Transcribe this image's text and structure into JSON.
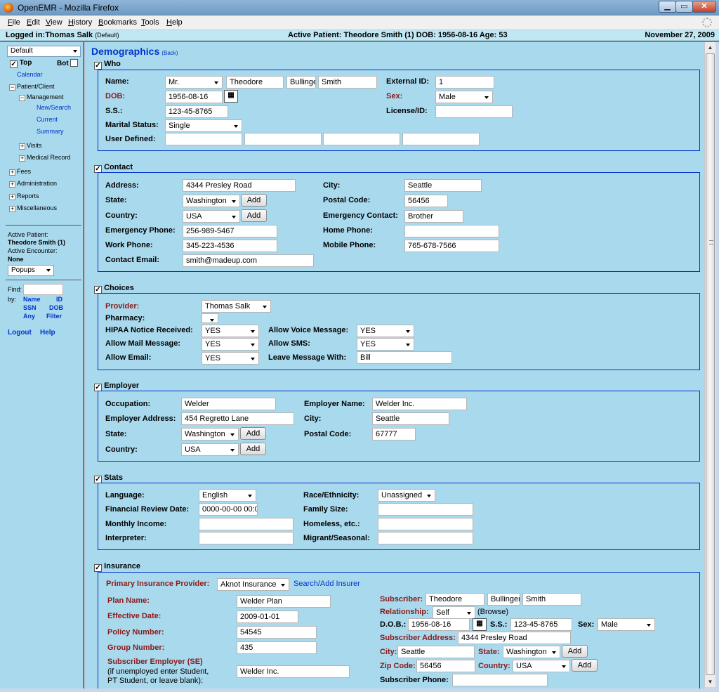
{
  "window": {
    "title": "OpenEMR - Mozilla Firefox",
    "min": "▁",
    "max": "▭",
    "close": "✕"
  },
  "menu": [
    "File",
    "Edit",
    "View",
    "History",
    "Bookmarks",
    "Tools",
    "Help"
  ],
  "topbar": {
    "logged_in": "Logged in:Thomas Salk",
    "default": "(Default)",
    "active_patient": "Active Patient: Theodore Smith (1) DOB: 1956-08-16 Age: 53",
    "date": "November 27, 2009"
  },
  "nav": {
    "view_select": "Default",
    "top_label": "Top",
    "bot_label": "Bot",
    "calendar": "Calendar",
    "patient_client": "Patient/Client",
    "management": "Management",
    "new_search": "New/Search",
    "current": "Current",
    "summary": "Summary",
    "visits": "Visits",
    "medical_record": "Medical Record",
    "fees": "Fees",
    "administration": "Administration",
    "reports": "Reports",
    "miscellaneous": "Miscellaneous",
    "active_patient_label": "Active Patient:",
    "active_patient_name": "Theodore Smith (1)",
    "active_encounter_label": "Active Encounter:",
    "active_encounter_value": "None",
    "popups": "Popups",
    "find": "Find:",
    "by": "by:",
    "name": "Name",
    "id": "ID",
    "ssn": "SSN",
    "dob": "DOB",
    "any": "Any",
    "filter": "Filter",
    "logout": "Logout",
    "help": "Help"
  },
  "page": {
    "title": "Demographics",
    "back": "(Back)"
  },
  "who": {
    "section": "Who",
    "name_label": "Name:",
    "title": "Mr.",
    "first": "Theodore",
    "middle": "Bullinge",
    "last": "Smith",
    "external_id_label": "External ID:",
    "external_id": "1",
    "dob_label": "DOB:",
    "dob": "1956-08-16",
    "sex_label": "Sex:",
    "sex": "Male",
    "ss_label": "S.S.:",
    "ss": "123-45-8765",
    "license_label": "License/ID:",
    "license": "",
    "marital_label": "Marital Status:",
    "marital": "Single",
    "user_defined_label": "User Defined:"
  },
  "contact": {
    "section": "Contact",
    "address_label": "Address:",
    "address": "4344 Presley Road",
    "city_label": "City:",
    "city": "Seattle",
    "state_label": "State:",
    "state": "Washington",
    "postal_label": "Postal Code:",
    "postal": "56456",
    "country_label": "Country:",
    "country": "USA",
    "em_contact_label": "Emergency Contact:",
    "em_contact": "Brother",
    "em_phone_label": "Emergency Phone:",
    "em_phone": "256-989-5467",
    "home_phone_label": "Home Phone:",
    "home_phone": "",
    "work_phone_label": "Work Phone:",
    "work_phone": "345-223-4536",
    "mobile_phone_label": "Mobile Phone:",
    "mobile_phone": "765-678-7566",
    "email_label": "Contact Email:",
    "email": "smith@madeup.com",
    "add": "Add"
  },
  "choices": {
    "section": "Choices",
    "provider_label": "Provider:",
    "provider": "Thomas Salk",
    "pharmacy_label": "Pharmacy:",
    "pharmacy": "",
    "hipaa_label": "HIPAA Notice Received:",
    "hipaa": "YES",
    "voice_label": "Allow Voice Message:",
    "voice": "YES",
    "mail_label": "Allow Mail Message:",
    "mail": "YES",
    "sms_label": "Allow SMS:",
    "sms": "YES",
    "allow_email_label": "Allow Email:",
    "allow_email": "YES",
    "leave_msg_label": "Leave Message With:",
    "leave_msg": "Bill"
  },
  "employer": {
    "section": "Employer",
    "occupation_label": "Occupation:",
    "occupation": "Welder",
    "emp_name_label": "Employer Name:",
    "emp_name": "Welder Inc.",
    "emp_address_label": "Employer Address:",
    "emp_address": "454 Regretto Lane",
    "city_label": "City:",
    "city": "Seattle",
    "state_label": "State:",
    "state": "Washington",
    "postal_label": "Postal Code:",
    "postal": "67777",
    "country_label": "Country:",
    "country": "USA"
  },
  "stats": {
    "section": "Stats",
    "language_label": "Language:",
    "language": "English",
    "race_label": "Race/Ethnicity:",
    "race": "Unassigned",
    "fin_review_label": "Financial Review Date:",
    "fin_review": "0000-00-00 00:0",
    "family_size_label": "Family Size:",
    "monthly_income_label": "Monthly Income:",
    "homeless_label": "Homeless, etc.:",
    "interpreter_label": "Interpreter:",
    "migrant_label": "Migrant/Seasonal:"
  },
  "insurance": {
    "section": "Insurance",
    "primary_label": "Primary Insurance Provider:",
    "primary": "Aknot Insurance",
    "search_add": "Search/Add Insurer",
    "plan_label": "Plan Name:",
    "plan": "Welder Plan",
    "effective_label": "Effective Date:",
    "effective": "2009-01-01",
    "policy_label": "Policy Number:",
    "policy": "54545",
    "group_label": "Group Number:",
    "group": "435",
    "se_label": "Subscriber Employer (SE)",
    "se_note1": "(if unemployed enter Student,",
    "se_note2": "PT Student, or leave blank):",
    "se": "Welder Inc.",
    "subscriber_label": "Subscriber:",
    "sub_first": "Theodore",
    "sub_middle": "Bullinger",
    "sub_last": "Smith",
    "relationship_label": "Relationship:",
    "relationship": "Self",
    "browse": "(Browse)",
    "dob_label": "D.O.B.:",
    "dob": "1956-08-16",
    "ss_label": "S.S.:",
    "ss": "123-45-8765",
    "sex_label": "Sex:",
    "sex": "Male",
    "sub_address_label": "Subscriber Address:",
    "sub_address": "4344 Presley Road",
    "city_label": "City:",
    "city": "Seattle",
    "state_label": "State:",
    "state": "Washington",
    "zip_label": "Zip Code:",
    "zip": "56456",
    "country_label": "Country:",
    "country": "USA",
    "phone_label": "Subscriber Phone:",
    "phone": ""
  }
}
